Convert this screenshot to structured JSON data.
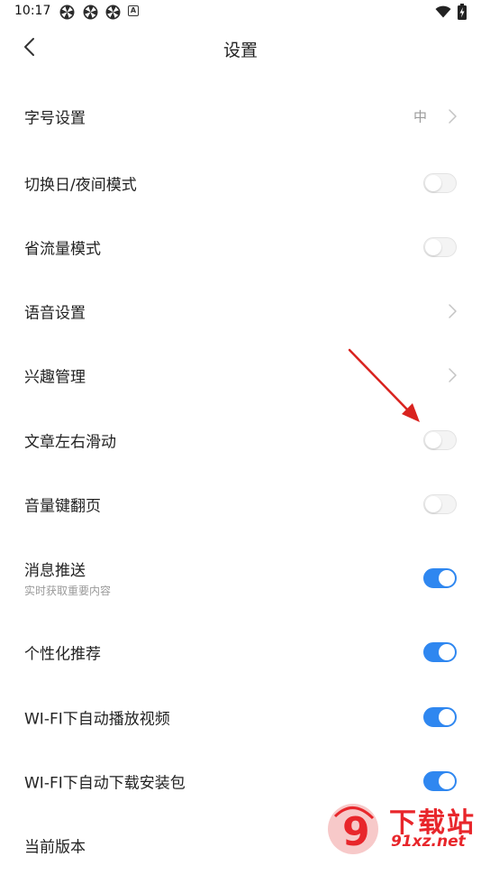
{
  "status_bar": {
    "time": "10:17",
    "notification_icons": [
      "pinwheel-icon",
      "pinwheel-icon",
      "pinwheel-icon",
      "a-badge-icon"
    ],
    "badge_letter": "A",
    "right_icons": [
      "wifi-icon",
      "battery-charging-icon"
    ]
  },
  "header": {
    "title": "设置",
    "back_icon": "chevron-left-icon"
  },
  "colors": {
    "toggle_on": "#2f87f0",
    "toggle_off": "#f4f4f4",
    "annotation_arrow": "#d9231f",
    "watermark": "#e8262b"
  },
  "settings": [
    {
      "label": "字号设置",
      "value": "中",
      "control": "chevron"
    },
    {
      "label": "切换日/夜间模式",
      "control": "toggle",
      "on": false
    },
    {
      "label": "省流量模式",
      "control": "toggle",
      "on": false
    },
    {
      "label": "语音设置",
      "control": "chevron"
    },
    {
      "label": "兴趣管理",
      "control": "chevron"
    },
    {
      "label": "文章左右滑动",
      "control": "toggle",
      "on": false
    },
    {
      "label": "音量键翻页",
      "control": "toggle",
      "on": false
    },
    {
      "label": "消息推送",
      "sub": "实时获取重要内容",
      "control": "toggle",
      "on": true
    },
    {
      "label": "个性化推荐",
      "control": "toggle",
      "on": true
    },
    {
      "label": "WI-FI下自动播放视频",
      "control": "toggle",
      "on": true
    },
    {
      "label": "WI-FI下自动下载安装包",
      "control": "toggle",
      "on": true
    },
    {
      "label": "当前版本",
      "control": "none"
    }
  ],
  "watermark": {
    "text_top": "下载站",
    "text_bottom": "91xz.net",
    "logo_glyph": "9"
  }
}
